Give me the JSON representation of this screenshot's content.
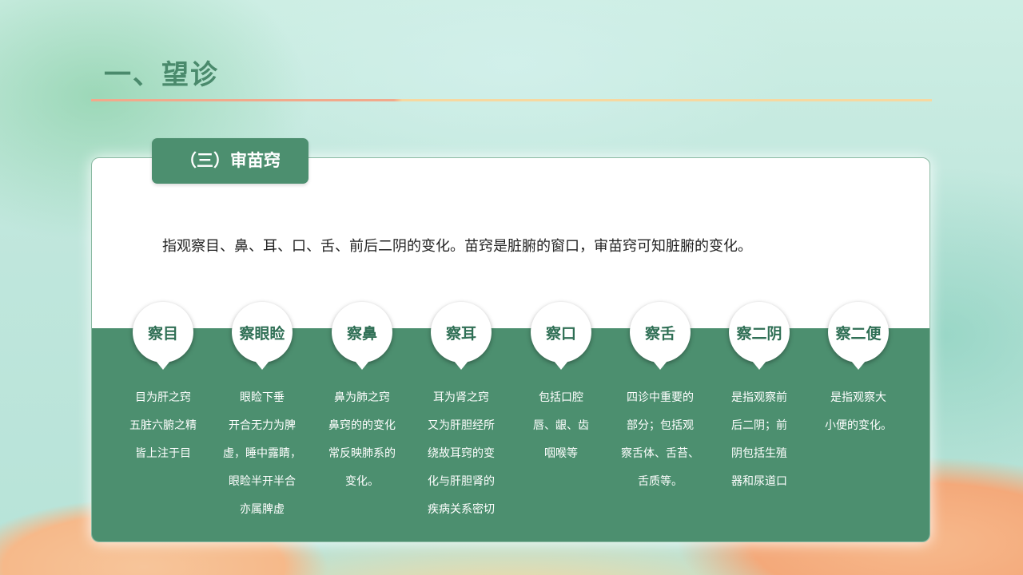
{
  "slide": {
    "title": "一、望诊",
    "section_tag": "（三）审苗窍",
    "description": "指观察目、鼻、耳、口、舌、前后二阴的变化。苗窍是脏腑的窗口，审苗窍可知脏腑的变化。",
    "colors": {
      "primary_green": "#4c8f6f",
      "title_green": "#4a8a6c",
      "accent_orange": "#f2a98b"
    },
    "items": [
      {
        "label": "察目",
        "lines": [
          "目为肝之窍",
          "五脏六腑之精",
          "皆上注于目"
        ]
      },
      {
        "label": "察眼睑",
        "lines": [
          "眼睑下垂",
          "开合无力为脾",
          "虚，睡中露睛，",
          "眼睑半开半合",
          "亦属脾虚"
        ]
      },
      {
        "label": "察鼻",
        "lines": [
          "鼻为肺之窍",
          "鼻窍的的变化",
          "常反映肺系的",
          "变化。"
        ]
      },
      {
        "label": "察耳",
        "lines": [
          "耳为肾之窍",
          "又为肝胆经所",
          "绕故耳窍的变",
          "化与肝胆肾的",
          "疾病关系密切"
        ]
      },
      {
        "label": "察口",
        "lines": [
          "包括口腔",
          "唇、龈、齿",
          "咽喉等"
        ]
      },
      {
        "label": "察舌",
        "lines": [
          "四诊中重要的",
          "部分；包括观",
          "察舌体、舌苔、",
          "舌质等。"
        ]
      },
      {
        "label": "察二阴",
        "lines": [
          "是指观察前",
          "后二阴；前",
          "阴包括生殖",
          "器和尿道口"
        ]
      },
      {
        "label": "察二便",
        "lines": [
          "是指观察大",
          "小便的变化。"
        ]
      }
    ]
  }
}
